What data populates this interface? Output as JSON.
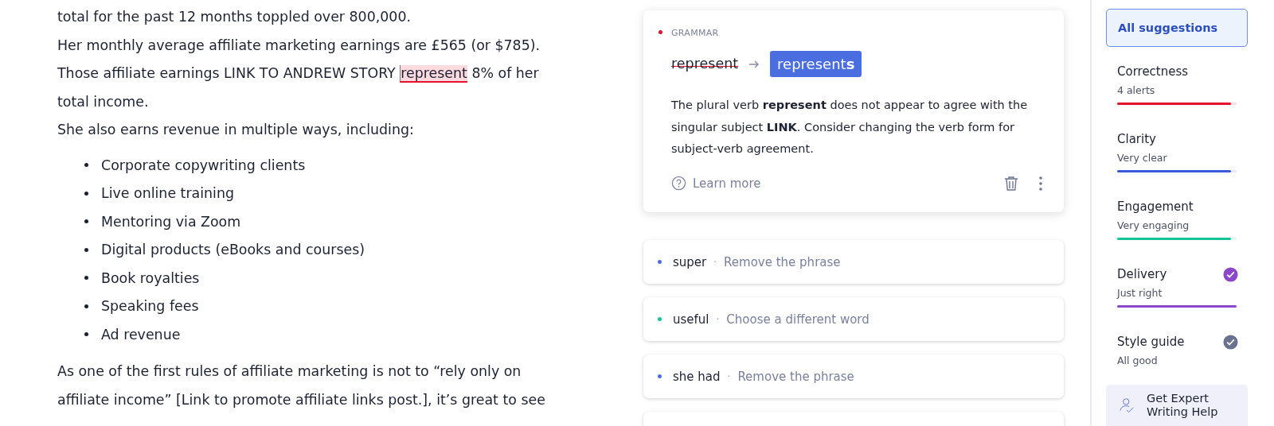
{
  "editor": {
    "paragraphs": [
      {
        "kind": "text",
        "text": "total for the past 12 months toppled over 800,000."
      },
      {
        "kind": "text",
        "text": "Her monthly average affiliate marketing earnings are £565 (or $785)."
      },
      {
        "kind": "flagged",
        "before": "Those affiliate earnings LINK TO ANDREW STORY ",
        "flag": "represent",
        "after": " 8% of her total income."
      },
      {
        "kind": "text",
        "text": "She also earns revenue in multiple ways, including:"
      },
      {
        "kind": "list",
        "items": [
          "Corporate copywriting clients",
          "Live online training",
          "Mentoring via Zoom",
          "Digital products (eBooks and courses)",
          "Book royalties",
          "Speaking fees",
          "Ad revenue"
        ]
      },
      {
        "kind": "text",
        "text": "As one of the first rules of affiliate marketing is not to “rely only on affiliate income” [Link to promote affiliate links post.], it’s great to see"
      }
    ]
  },
  "active_card": {
    "category": "GRAMMAR",
    "color": "#e5112d",
    "original": "represent",
    "replacement": "represent**s**",
    "explanation": "The plural verb **represent** does not appear to agree with the singular subject **LINK**. Consider changing the verb form for subject-verb agreement.",
    "learn_more": "Learn more"
  },
  "suggestions": [
    {
      "word": "super",
      "separator": "·",
      "hint": "Remove the phrase",
      "color": "#4a6ee0"
    },
    {
      "word": "useful",
      "separator": "·",
      "hint": "Choose a different word",
      "color": "#15c39a"
    },
    {
      "word": "she had",
      "separator": "·",
      "hint": "Remove the phrase",
      "color": "#4a6ee0"
    }
  ],
  "sidebar": {
    "all_suggestions": {
      "label": "All suggestions",
      "selected": true
    },
    "categories": [
      {
        "name": "Correctness",
        "status": "4 alerts",
        "color": "#e5112d",
        "level": 0.95,
        "checked": false
      },
      {
        "name": "Clarity",
        "status": "Very clear",
        "color": "#3a5bd9",
        "level": 0.95,
        "checked": false
      },
      {
        "name": "Engagement",
        "status": "Very engaging",
        "color": "#15c39a",
        "level": 0.95,
        "checked": false
      },
      {
        "name": "Delivery",
        "status": "Just right",
        "color": "#8b46c9",
        "level": 1,
        "checked": true
      },
      {
        "name": "Style guide",
        "status": "All good",
        "color": "#6b7290",
        "checked": true
      }
    ],
    "expert_help": "Get Expert Writing Help"
  }
}
